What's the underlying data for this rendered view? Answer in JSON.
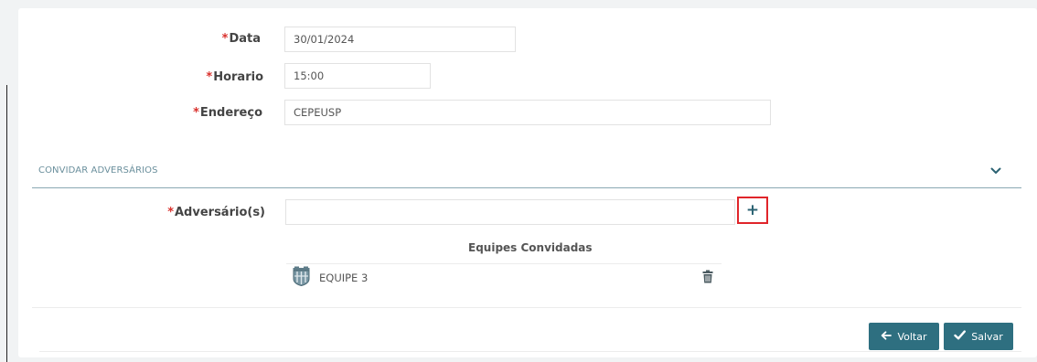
{
  "form": {
    "required_marker": "*",
    "date": {
      "label": "Data",
      "value": "30/01/2024"
    },
    "time": {
      "label": "Horario",
      "value": "15:00"
    },
    "address": {
      "label": "Endereço",
      "value": "CEPEUSP"
    }
  },
  "invite_section": {
    "title": "CONVIDAR ADVERSÁRIOS",
    "opponents_label": "Adversário(s)",
    "opponents_value": "",
    "add_symbol": "+",
    "invited_title": "Equipes Convidadas",
    "teams": [
      {
        "name": "EQUIPE 3"
      }
    ]
  },
  "actions": {
    "back_label": "Voltar",
    "save_label": "Salvar"
  },
  "icons": {
    "collapse": "chevron-down-icon",
    "team": "team-crest-icon",
    "delete": "trash-icon",
    "back": "arrow-left-icon",
    "save": "check-icon"
  },
  "colors": {
    "primary": "#2e6f80",
    "required": "#d9302c",
    "highlight": "#e0252a",
    "section": "#6a8f9c"
  }
}
